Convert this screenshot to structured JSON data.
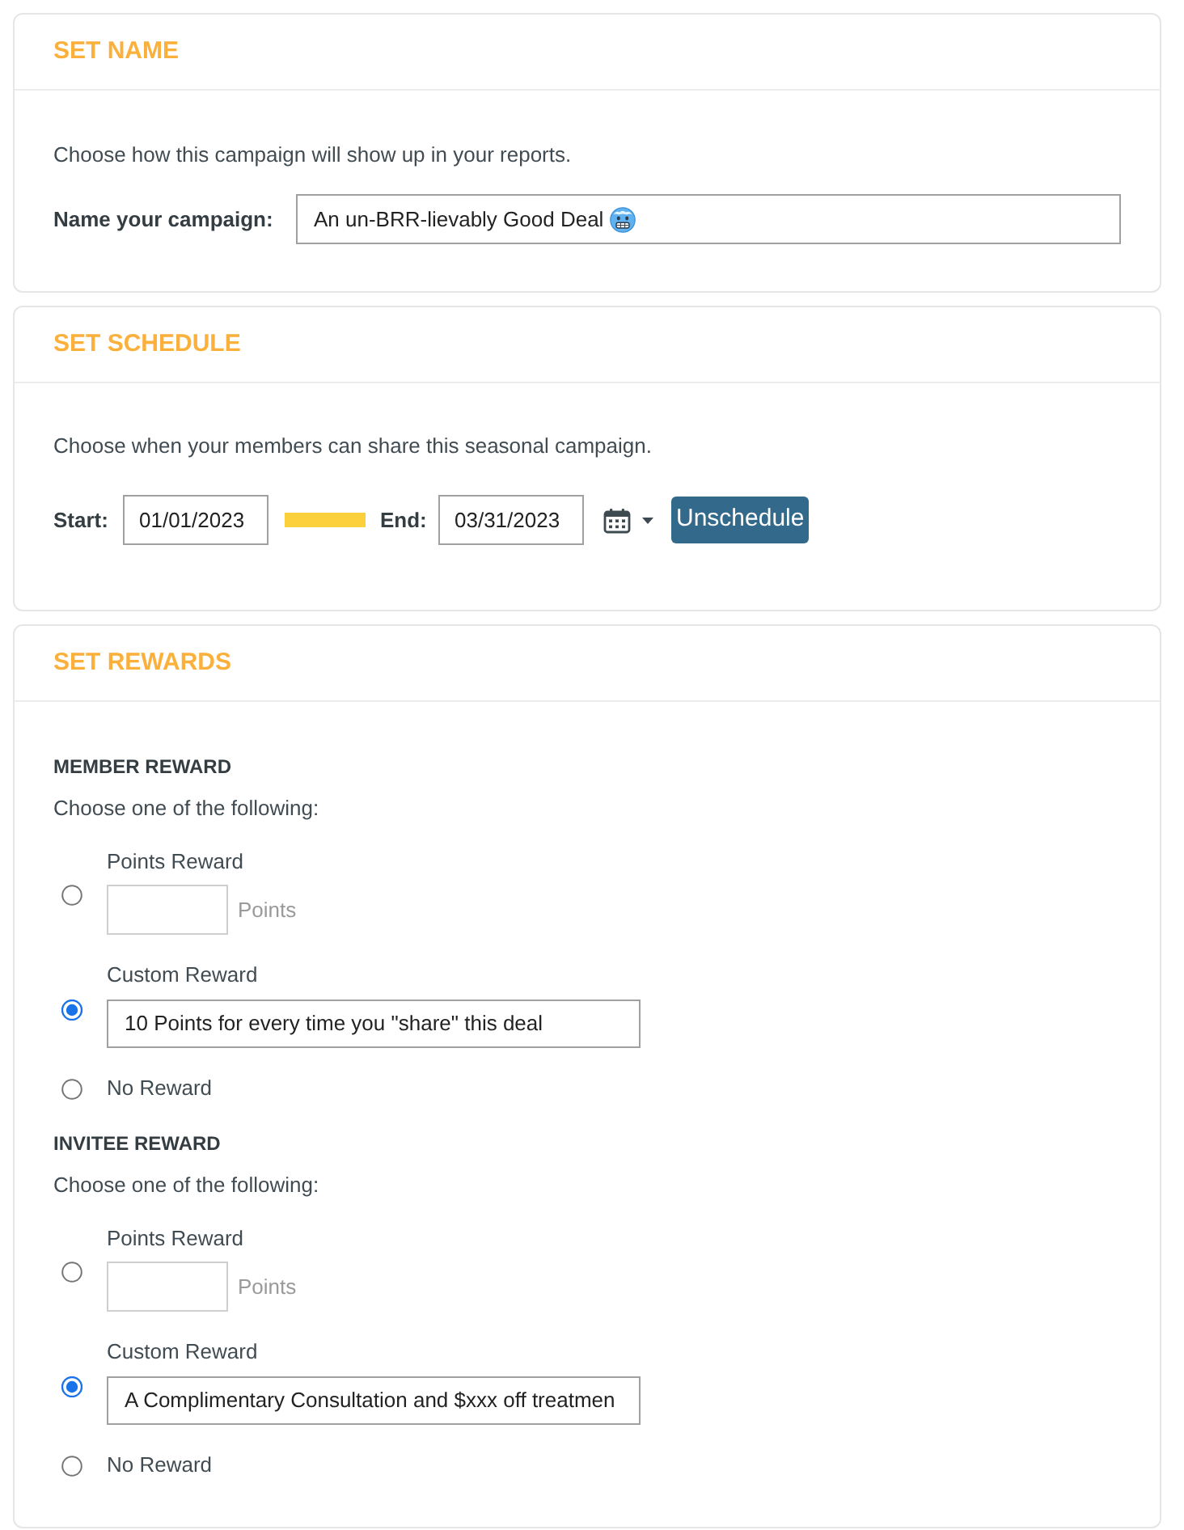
{
  "sections": [
    {
      "kind": "name",
      "title": "SET NAME",
      "description": "Choose how this campaign will show up in your reports.",
      "field": {
        "label": "Name your campaign:",
        "value": "An un-BRR-lievably Good Deal"
      }
    },
    {
      "kind": "schedule",
      "title": "SET SCHEDULE",
      "description": "Choose when your members can share this seasonal campaign.",
      "start": {
        "label": "Start:",
        "value": "01/01/2023"
      },
      "end": {
        "label": "End:",
        "value": "03/31/2023"
      },
      "button": "Unschedule"
    },
    {
      "kind": "rewards",
      "title": "SET REWARDS",
      "groups": [
        {
          "heading": "MEMBER REWARD",
          "prompt": "Choose one of the following:",
          "options": [
            {
              "kind": "points",
              "label": "Points Reward",
              "unit": "Points",
              "selected": false
            },
            {
              "kind": "custom",
              "label": "Custom Reward",
              "value": "10 Points for every time you \"share\" this deal",
              "selected": true
            },
            {
              "kind": "none",
              "label": "No Reward",
              "selected": false
            }
          ]
        },
        {
          "heading": "INVITEE REWARD",
          "prompt": "Choose one of the following:",
          "options": [
            {
              "kind": "points",
              "label": "Points Reward",
              "unit": "Points",
              "selected": false
            },
            {
              "kind": "custom",
              "label": "Custom Reward",
              "value": "A Complimentary Consultation and $xxx off treatmen",
              "selected": true
            },
            {
              "kind": "none",
              "label": "No Reward",
              "selected": false
            }
          ]
        }
      ]
    }
  ]
}
